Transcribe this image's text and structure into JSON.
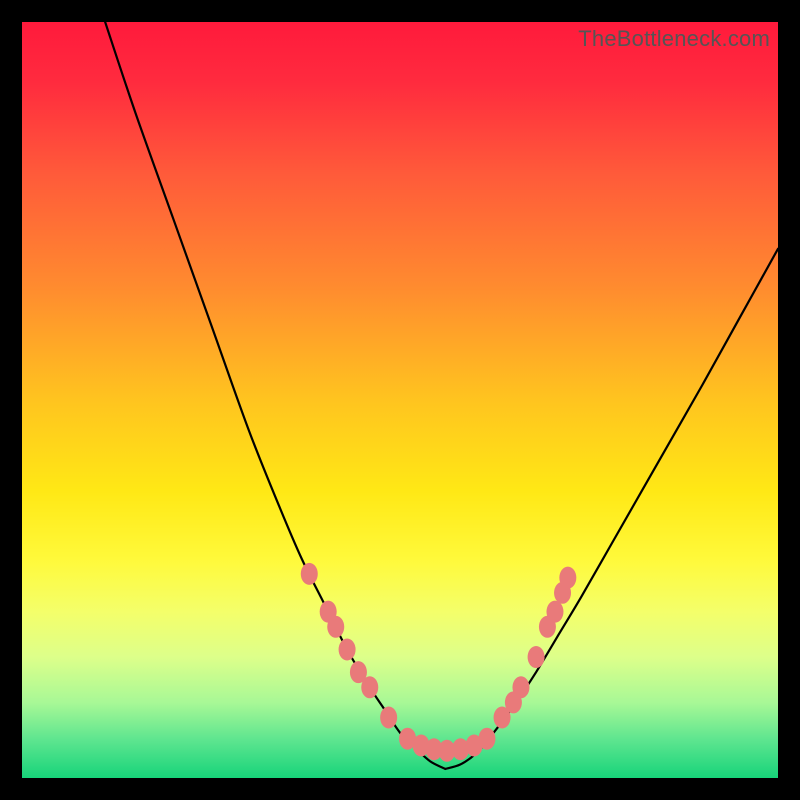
{
  "watermark": "TheBottleneck.com",
  "chart_data": {
    "type": "line",
    "title": "",
    "xlabel": "",
    "ylabel": "",
    "xlim": [
      0,
      100
    ],
    "ylim": [
      0,
      100
    ],
    "left_curve": {
      "x": [
        11,
        15,
        20,
        25,
        30,
        34,
        37,
        40,
        43,
        46,
        48,
        50,
        52,
        54,
        56
      ],
      "values": [
        100,
        88,
        74,
        60,
        46,
        36,
        29,
        23,
        17,
        12,
        9,
        6,
        4,
        2.2,
        1.2
      ]
    },
    "right_curve": {
      "x": [
        56,
        58,
        60,
        62,
        65,
        68,
        71,
        74,
        78,
        82,
        86,
        90,
        95,
        100
      ],
      "values": [
        1.2,
        1.8,
        3.2,
        5.5,
        9.5,
        14,
        19,
        24,
        31,
        38,
        45,
        52,
        61,
        70
      ]
    },
    "markers_left": [
      {
        "x": 38,
        "y": 27
      },
      {
        "x": 40.5,
        "y": 22
      },
      {
        "x": 41.5,
        "y": 20
      },
      {
        "x": 43,
        "y": 17
      },
      {
        "x": 44.5,
        "y": 14
      },
      {
        "x": 46,
        "y": 12
      },
      {
        "x": 48.5,
        "y": 8
      }
    ],
    "markers_bottom": [
      {
        "x": 51,
        "y": 5.2
      },
      {
        "x": 52.8,
        "y": 4.3
      },
      {
        "x": 54.5,
        "y": 3.8
      },
      {
        "x": 56.2,
        "y": 3.6
      },
      {
        "x": 58,
        "y": 3.8
      },
      {
        "x": 59.8,
        "y": 4.3
      },
      {
        "x": 61.5,
        "y": 5.2
      }
    ],
    "markers_right": [
      {
        "x": 63.5,
        "y": 8
      },
      {
        "x": 65,
        "y": 10
      },
      {
        "x": 66,
        "y": 12
      },
      {
        "x": 68,
        "y": 16
      },
      {
        "x": 69.5,
        "y": 20
      },
      {
        "x": 70.5,
        "y": 22
      },
      {
        "x": 71.5,
        "y": 24.5
      },
      {
        "x": 72.2,
        "y": 26.5
      }
    ],
    "colors": {
      "marker_fill": "#e97a7a",
      "marker_stroke": "#cc5a5a",
      "curve": "#000000"
    },
    "gradient_stops": [
      {
        "offset": 0,
        "color": "#ff1a3c"
      },
      {
        "offset": 0.08,
        "color": "#ff2b3e"
      },
      {
        "offset": 0.2,
        "color": "#ff5a3a"
      },
      {
        "offset": 0.35,
        "color": "#ff8b2f"
      },
      {
        "offset": 0.5,
        "color": "#ffc41f"
      },
      {
        "offset": 0.62,
        "color": "#ffe815"
      },
      {
        "offset": 0.71,
        "color": "#fff93a"
      },
      {
        "offset": 0.78,
        "color": "#f4ff6a"
      },
      {
        "offset": 0.84,
        "color": "#ddff8a"
      },
      {
        "offset": 0.9,
        "color": "#a8f896"
      },
      {
        "offset": 0.95,
        "color": "#5de58f"
      },
      {
        "offset": 1.0,
        "color": "#17d47a"
      }
    ]
  }
}
